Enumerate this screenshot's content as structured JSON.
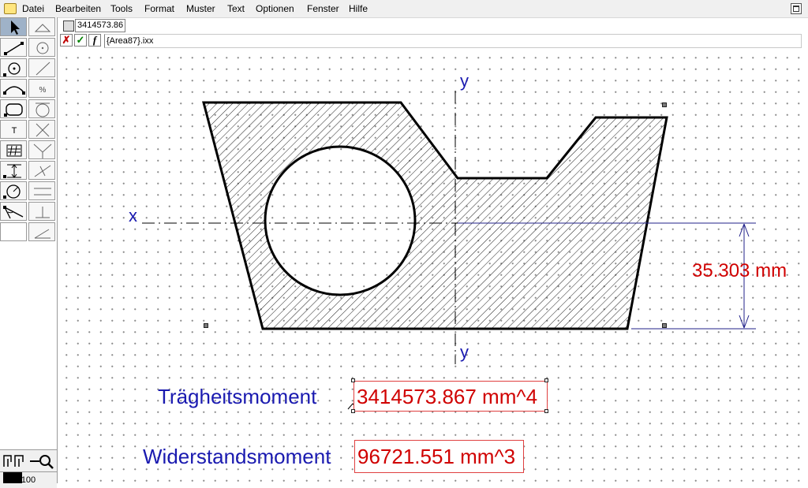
{
  "menu": {
    "items": [
      "Datei",
      "Bearbeiten",
      "Tools",
      "Format",
      "Muster",
      "Text",
      "Optionen",
      "Fenster",
      "Hilfe"
    ]
  },
  "formula_bar": {
    "value": "3414573.86",
    "expression": "{Area87}.ixx",
    "cancel_label": "✗",
    "confirm_label": "✓",
    "function_label": "f"
  },
  "toolbox": {
    "text_tool_label": "T",
    "zoom_value": "100"
  },
  "drawing": {
    "axis_labels": {
      "x": "x",
      "y_top": "y",
      "y_bottom": "y"
    },
    "dimension_text": "35.303 mm",
    "results": [
      {
        "label": "Trägheitsmoment",
        "value": "3414573.867 mm^4"
      },
      {
        "label": "Widerstandsmoment",
        "value": "96721.551 mm^3"
      }
    ]
  },
  "colors": {
    "label_blue": "#1a1ab0",
    "value_red": "#d00000",
    "dimension_line": "#20208a",
    "tool_active": "#9fb2c8"
  }
}
